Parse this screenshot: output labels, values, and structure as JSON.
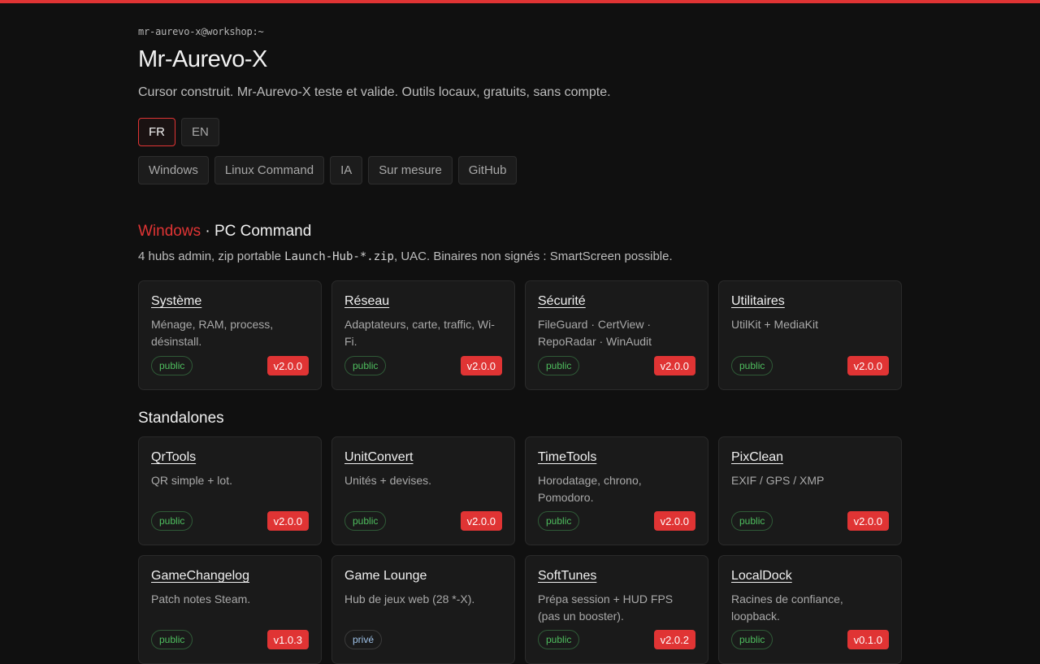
{
  "prompt": "mr-aurevo-x@workshop:~",
  "site_title": "Mr-Aurevo-X",
  "tagline": "Cursor construit. Mr-Aurevo-X teste et valide. Outils locaux, gratuits, sans compte.",
  "accent_color": "#e03434",
  "languages": [
    {
      "label": "FR",
      "active": true
    },
    {
      "label": "EN",
      "active": false
    }
  ],
  "nav": [
    "Windows",
    "Linux Command",
    "IA",
    "Sur mesure",
    "GitHub"
  ],
  "windows_section": {
    "title_accent": "Windows",
    "title_rest": " · PC Command",
    "desc_pre": "4 hubs admin, zip portable ",
    "desc_code": "Launch-Hub-*.zip",
    "desc_post": ", UAC. Binaires non signés : SmartScreen possible.",
    "cards": [
      {
        "title": "Système",
        "desc": "Ménage, RAM, process, désinstall.",
        "badge": "public",
        "version": "v2.0.0"
      },
      {
        "title": "Réseau",
        "desc": "Adaptateurs, carte, traffic, Wi-Fi.",
        "badge": "public",
        "version": "v2.0.0"
      },
      {
        "title": "Sécurité",
        "desc": "FileGuard · CertView · RepoRadar · WinAudit",
        "badge": "public",
        "version": "v2.0.0"
      },
      {
        "title": "Utilitaires",
        "desc": "UtilKit + MediaKit",
        "badge": "public",
        "version": "v2.0.0"
      }
    ]
  },
  "standalones_section": {
    "title": "Standalones",
    "cards": [
      {
        "title": "QrTools",
        "desc": "QR simple + lot.",
        "badge": "public",
        "version": "v2.0.0",
        "link": true
      },
      {
        "title": "UnitConvert",
        "desc": "Unités + devises.",
        "badge": "public",
        "version": "v2.0.0",
        "link": true
      },
      {
        "title": "TimeTools",
        "desc": "Horodatage, chrono, Pomodoro.",
        "badge": "public",
        "version": "v2.0.0",
        "link": true
      },
      {
        "title": "PixClean",
        "desc": "EXIF / GPS / XMP",
        "badge": "public",
        "version": "v2.0.0",
        "link": true
      },
      {
        "title": "GameChangelog",
        "desc": "Patch notes Steam.",
        "badge": "public",
        "version": "v1.0.3",
        "link": true
      },
      {
        "title": "Game Lounge",
        "desc": "Hub de jeux web (28 *-X).",
        "badge": "privé",
        "version": "",
        "link": false
      },
      {
        "title": "SoftTunes",
        "desc": "Prépa session + HUD FPS (pas un booster).",
        "badge": "public",
        "version": "v2.0.2",
        "link": true
      },
      {
        "title": "LocalDock",
        "desc": "Racines de confiance, loopback.",
        "badge": "public",
        "version": "v0.1.0",
        "link": true
      }
    ]
  }
}
